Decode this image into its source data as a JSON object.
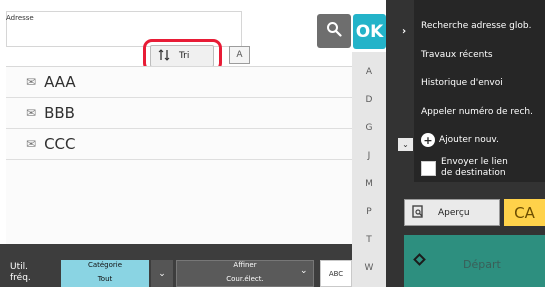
{
  "address": {
    "label": "Adresse"
  },
  "toolbar": {
    "ok_label": "OK",
    "sort_label": "Tri",
    "text_size_label": "A"
  },
  "list": {
    "items": [
      {
        "name": "AAA"
      },
      {
        "name": "BBB"
      },
      {
        "name": "CCC"
      }
    ]
  },
  "alpha_index": [
    "A",
    "D",
    "G",
    "J",
    "M",
    "P",
    "T",
    "W"
  ],
  "bottom_bar": {
    "freq_line1": "Util.",
    "freq_line2": "fréq.",
    "category_header": "Catégorie",
    "category_value": "Tout",
    "refine_header": "Affiner",
    "refine_value": "Cour.élect.",
    "abc_label": "ABC"
  },
  "sidebar": {
    "items": [
      "Recherche adresse glob.",
      "Travaux récents",
      "Historique d'envoi",
      "Appeler numéro de rech."
    ],
    "add_new": "Ajouter nouv.",
    "send_link_line1": "Envoyer le lien",
    "send_link_line2": "de destination"
  },
  "actions": {
    "preview_label": "Aperçu",
    "ca_label": "CA",
    "start_label": "Départ"
  },
  "colors": {
    "accent": "#23b3c9",
    "highlight": "#e81c36",
    "start": "#2d8f7f",
    "ca": "#ffd24a"
  }
}
